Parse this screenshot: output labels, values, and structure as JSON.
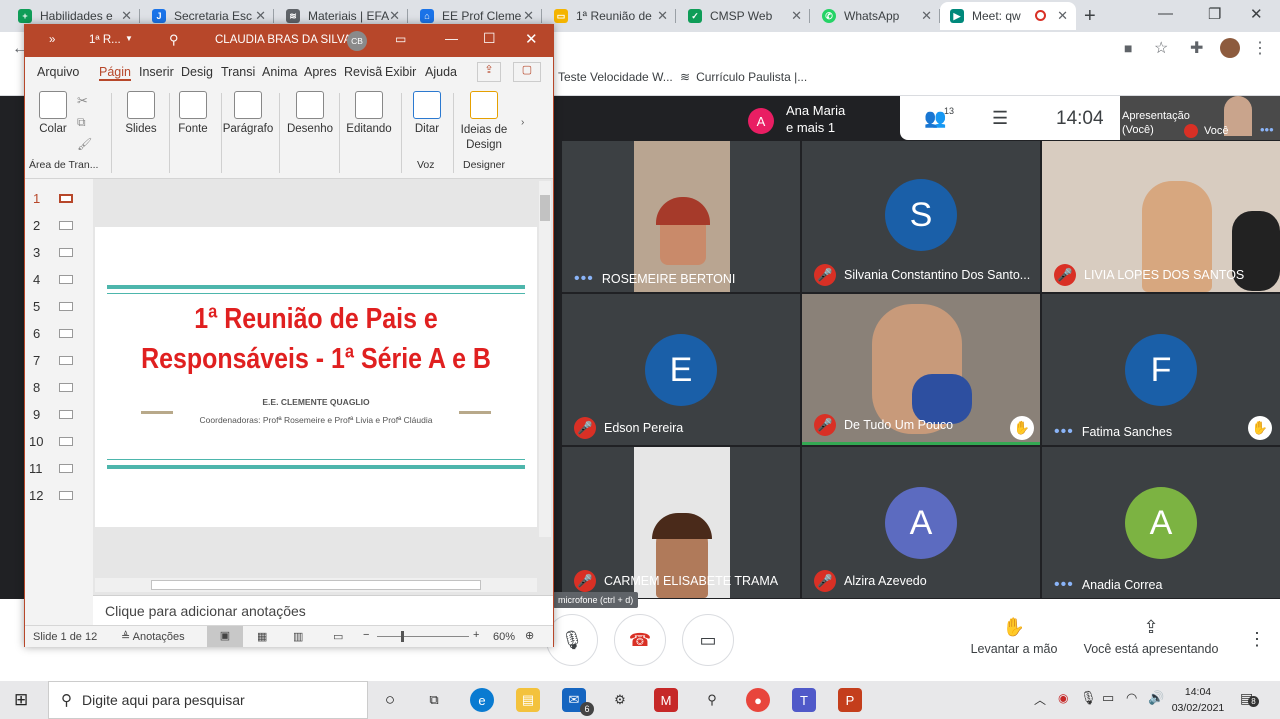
{
  "browser": {
    "tabs": [
      {
        "title": "Habilidades e",
        "color": "#0f9d58",
        "glyph": "+"
      },
      {
        "title": "Secretaria Esc",
        "color": "#1a73e8",
        "glyph": "J"
      },
      {
        "title": "Materiais | EFA",
        "color": "#5f6368",
        "glyph": "≋"
      },
      {
        "title": "EE Prof Cleme",
        "color": "#1a73e8",
        "glyph": "⌂"
      },
      {
        "title": "1ª Reunião de",
        "color": "#f4b400",
        "glyph": "▭"
      },
      {
        "title": "CMSP Web",
        "color": "#0f9d58",
        "glyph": "✓"
      },
      {
        "title": "WhatsApp",
        "color": "#25d366",
        "glyph": "✆"
      },
      {
        "title": "Meet: qw",
        "color": "#00897b",
        "glyph": "▶"
      }
    ],
    "bookmarks": [
      "Teste Velocidade W...",
      "Currículo Paulista |..."
    ]
  },
  "meet": {
    "people": {
      "name": "Ana Maria",
      "more": "e mais 1",
      "initial": "A"
    },
    "participants_count": "13",
    "clock": "14:04",
    "presentation_label": "Apresentação (Você)",
    "self_label": "Você",
    "tiles": [
      {
        "name": "ROSEMEIRE BERTONI",
        "kind": "video"
      },
      {
        "name": "Silvania Constantino Dos Santo...",
        "kind": "avatar",
        "initial": "S",
        "color": "#1a5fa8"
      },
      {
        "name": "LIVIA LOPES DOS SANTOS",
        "kind": "video"
      },
      {
        "name": "Edson Pereira",
        "kind": "avatar",
        "initial": "E",
        "color": "#1a5fa8"
      },
      {
        "name": "De Tudo Um Pouco",
        "kind": "video"
      },
      {
        "name": "Fatima Sanches",
        "kind": "avatar",
        "initial": "F",
        "color": "#1a5fa8"
      },
      {
        "name": "CARMEM ELISABETE TRAMA",
        "kind": "video"
      },
      {
        "name": "Alzira Azevedo",
        "kind": "avatar",
        "initial": "A",
        "color": "#5c6bc0"
      },
      {
        "name": "Anadia Correa",
        "kind": "avatar",
        "initial": "A",
        "color": "#7cb342"
      }
    ],
    "tooltip": "microfone (ctrl + d)",
    "raise_hand": "Levantar a mão",
    "presenting": "Você está apresentando"
  },
  "ppt": {
    "window_title": "1ª R...",
    "user_name": "CLAUDIA BRAS DA SILVA",
    "user_initials": "CB",
    "tabs": [
      "Arquivo",
      "Págin",
      "Inserir",
      "Desig",
      "Transi",
      "Anima",
      "Apres",
      "Revisã",
      "Exibir",
      "Ajuda"
    ],
    "ribbon": [
      {
        "label": "Colar",
        "group": "Área de Tran..."
      },
      {
        "label": "Slides"
      },
      {
        "label": "Fonte"
      },
      {
        "label": "Parágrafo"
      },
      {
        "label": "Desenho"
      },
      {
        "label": "Editando"
      },
      {
        "label": "Ditar",
        "group": "Voz"
      },
      {
        "label": "Ideias de Design",
        "group": "Designer"
      }
    ],
    "slide_numbers": [
      "1",
      "2",
      "3",
      "4",
      "5",
      "6",
      "7",
      "8",
      "9",
      "10",
      "11",
      "12"
    ],
    "slide": {
      "title_line1": "1ª Reunião de Pais e",
      "title_line2": "Responsáveis - 1ª Série A e B",
      "school": "E.E. CLEMENTE QUAGLIO",
      "coordinators": "Coordenadoras: Profª Rosemeire e Profª Livia e Profª Cláudia"
    },
    "notes_placeholder": "Clique para adicionar anotações",
    "status_slide": "Slide 1 de 12",
    "status_notes": "Anotações",
    "zoom": "60%"
  },
  "taskbar": {
    "search_placeholder": "Digite aqui para pesquisar",
    "time": "14:04",
    "date": "03/02/2021",
    "mail_badge": "6",
    "notif_badge": "8"
  },
  "colors": {
    "ppt_accent": "#b7472a",
    "meet_bg": "#202124",
    "slide_title": "#e02020",
    "teal": "#4db6ac"
  }
}
